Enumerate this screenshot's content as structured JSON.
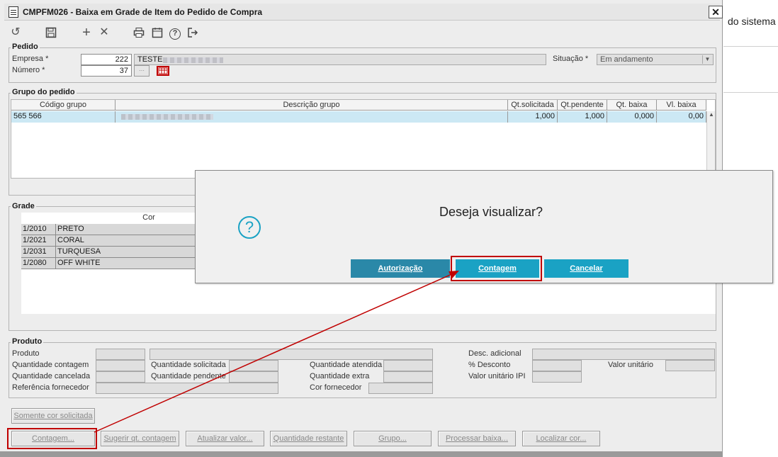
{
  "window": {
    "title": "CMPFM026 - Baixa em Grade de Item do Pedido de Compra",
    "close_label": "✕",
    "background_text": "do sistema"
  },
  "toolbar": {
    "undo_icon": "↺",
    "save_icon": "save-icon",
    "add_icon": "+",
    "delete_icon": "✕",
    "print_icon": "print-icon",
    "calendar_icon": "calendar-icon",
    "help_icon": "?",
    "exit_icon": "exit-icon"
  },
  "pedido": {
    "title": "Pedido",
    "empresa_label": "Empresa *",
    "empresa_value": "222",
    "empresa_name": "TESTE",
    "numero_label": "Número *",
    "numero_value": "37",
    "situacao_label": "Situação *",
    "situacao_value": "Em andamento"
  },
  "grupo": {
    "title": "Grupo do pedido",
    "columns": [
      "Código grupo",
      "Descrição grupo",
      "Qt.solicitada",
      "Qt.pendente",
      "Qt. baixa",
      "Vl. baixa"
    ],
    "rows": [
      {
        "codigo": "565 566",
        "descricao": "",
        "qt_solicitada": "1,000",
        "qt_pendente": "1,000",
        "qt_baixa": "0,000",
        "vl_baixa": "0,00"
      }
    ]
  },
  "grade": {
    "title": "Grade",
    "column": "Cor",
    "rows": [
      {
        "code": "1/2010",
        "name": "PRETO"
      },
      {
        "code": "1/2021",
        "name": "CORAL"
      },
      {
        "code": "1/2031",
        "name": "TURQUESA"
      },
      {
        "code": "1/2080",
        "name": "OFF WHITE"
      }
    ]
  },
  "produto": {
    "title": "Produto",
    "produto_label": "Produto",
    "qt_contagem_label": "Quantidade contagem",
    "qt_cancelada_label": "Quantidade cancelada",
    "ref_fornecedor_label": "Referência fornecedor",
    "qt_solicitada_label": "Quantidade solicitada",
    "qt_pendente_label": "Quantidade pendente",
    "qt_atendida_label": "Quantidade atendida",
    "qt_extra_label": "Quantidade extra",
    "cor_fornecedor_label": "Cor fornecedor",
    "desc_adicional_label": "Desc. adicional",
    "desconto_label": "% Desconto",
    "valor_unitario_label": "Valor unitário",
    "valor_unitario_ipi_label": "Valor unitário IPI"
  },
  "buttons": {
    "somente_cor": "Somente cor solicitada",
    "contagem": "Contagem...",
    "sugerir": "Sugerir qt. contagem",
    "atualizar": "Atualizar valor...",
    "quantidade_restante": "Quantidade restante",
    "grupo": "Grupo...",
    "processar": "Processar baixa...",
    "localizar": "Localizar cor..."
  },
  "dialog": {
    "question": "Deseja visualizar?",
    "autorizacao": "Autorização",
    "contagem": "Contagem",
    "cancelar": "Cancelar"
  },
  "colors": {
    "dialog_button_dark": "#2a88a8",
    "dialog_button": "#1aa2c4",
    "highlight": "#c00000",
    "selected_row": "#cce8f4"
  }
}
